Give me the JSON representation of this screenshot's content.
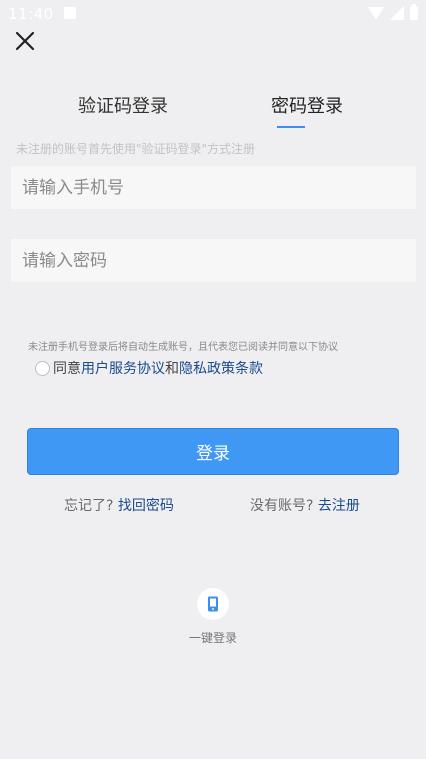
{
  "status_bar": {
    "time": "11:40"
  },
  "tabs": [
    {
      "label": "验证码登录",
      "active": false
    },
    {
      "label": "密码登录",
      "active": true
    }
  ],
  "hint": "未注册的账号首先使用\"验证码登录\"方式注册",
  "inputs": {
    "phone_placeholder": "请输入手机号",
    "password_placeholder": "请输入密码"
  },
  "agreement": {
    "note": "未注册手机号登录后将自动生成账号，且代表您已阅读并同意以下协议",
    "prefix": "同意",
    "service_link": "用户服务协议",
    "and": "和",
    "privacy_link": "隐私政策条款",
    "checked": false
  },
  "login_button": "登录",
  "forgot": {
    "text": "忘记了?",
    "link": "找回密码"
  },
  "register": {
    "text": "没有账号?",
    "link": "去注册"
  },
  "one_key": {
    "label": "一键登录"
  },
  "colors": {
    "accent": "#4098f5",
    "link": "#1a4b8c",
    "background": "#efeff1"
  }
}
